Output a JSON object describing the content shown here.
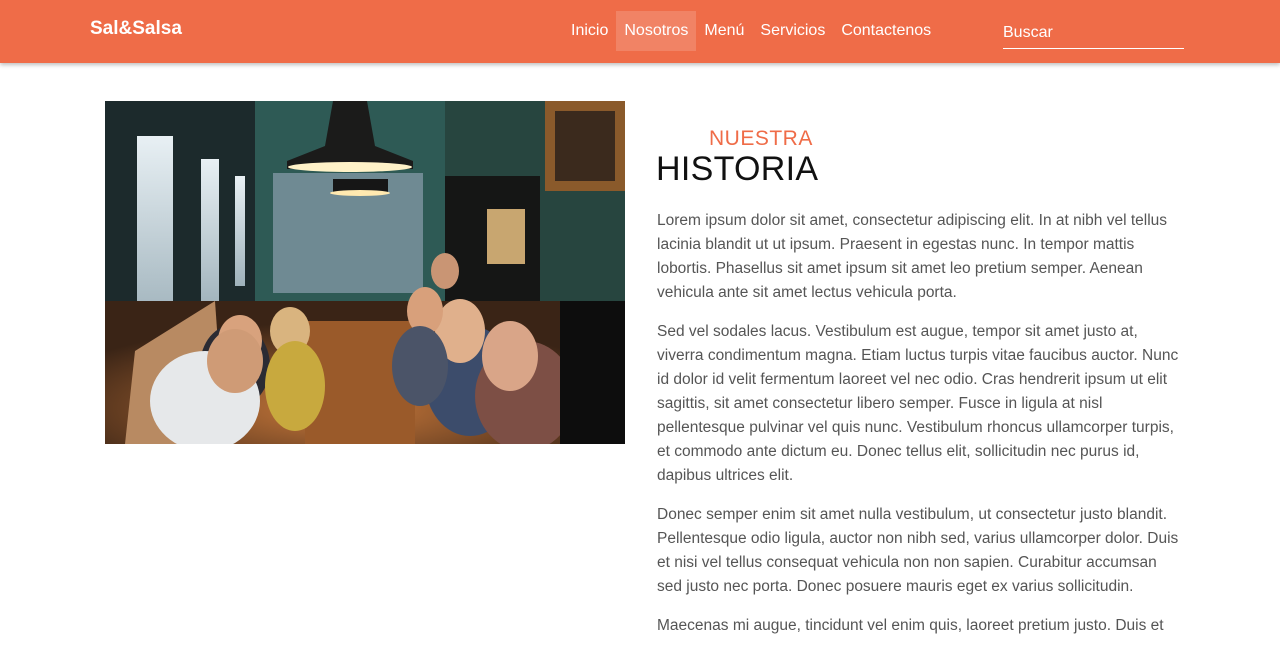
{
  "nav": {
    "brand": "Sal&Salsa",
    "links": [
      "Inicio",
      "Nosotros",
      "Menú",
      "Servicios",
      "Contactenos"
    ],
    "active": "Nosotros",
    "search_placeholder": "Buscar"
  },
  "colors": {
    "accent": "#ef6c48",
    "text": "#555555",
    "heading": "#111111"
  },
  "section": {
    "eyebrow": "NUESTRA",
    "title": "HISTORIA",
    "paragraphs": [
      "Lorem ipsum dolor sit amet, consectetur adipiscing elit. In at nibh vel tellus lacinia blandit ut ut ipsum. Praesent in egestas nunc. In tempor mattis lobortis. Phasellus sit amet ipsum sit amet leo pretium semper. Aenean vehicula ante sit amet lectus vehicula porta.",
      "Sed vel sodales lacus. Vestibulum est augue, tempor sit amet justo at, viverra condimentum magna. Etiam luctus turpis vitae faucibus auctor. Nunc id dolor id velit fermentum laoreet vel nec odio. Cras hendrerit ipsum ut elit sagittis, sit amet consectetur libero semper. Fusce in ligula at nisl pellentesque pulvinar vel quis nunc. Vestibulum rhoncus ullamcorper turpis, et commodo ante dictum eu. Donec tellus elit, sollicitudin nec purus id, dapibus ultrices elit.",
      "Donec semper enim sit amet nulla vestibulum, ut consectetur justo blandit. Pellentesque odio ligula, auctor non nibh sed, varius ullamcorper dolor. Duis et nisi vel tellus consequat vehicula non non sapien. Curabitur accumsan sed justo nec porta. Donec posuere mauris eget ex varius sollicitudin.",
      "Maecenas mi augue, tincidunt vel enim quis, laoreet pretium justo. Duis et"
    ]
  }
}
